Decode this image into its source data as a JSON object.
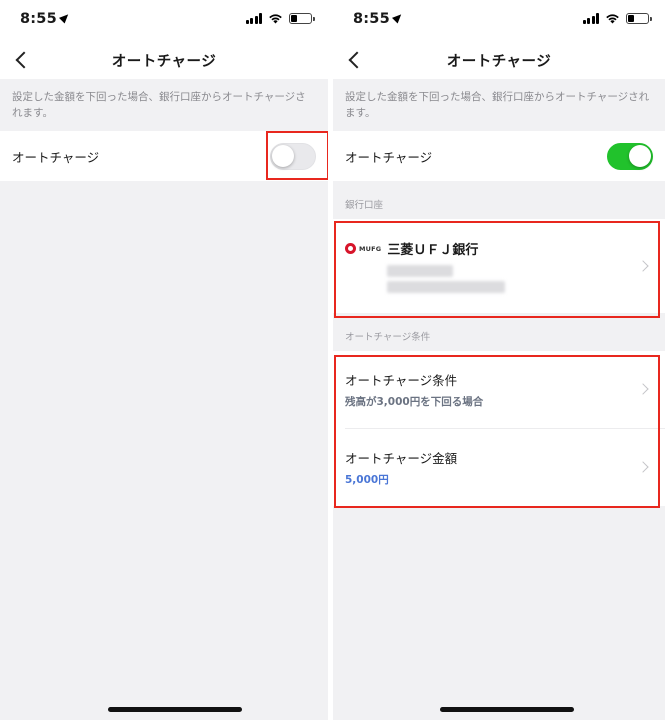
{
  "status_bar": {
    "time": "8:55"
  },
  "left_screen": {
    "nav_title": "オートチャージ",
    "description": "設定した金額を下回った場合、銀行口座からオートチャージされます。",
    "auto_charge_label": "オートチャージ",
    "auto_charge_enabled": false
  },
  "right_screen": {
    "nav_title": "オートチャージ",
    "description": "設定した金額を下回った場合、銀行口座からオートチャージされます。",
    "auto_charge_label": "オートチャージ",
    "auto_charge_enabled": true,
    "bank_section_header": "銀行口座",
    "bank": {
      "logo_text": "MUFG",
      "name": "三菱ＵＦＪ銀行"
    },
    "conditions_section_header": "オートチャージ条件",
    "conditions": [
      {
        "title": "オートチャージ条件",
        "value": "残高が3,000円を下回る場合"
      },
      {
        "title": "オートチャージ金額",
        "value": "5,000円"
      }
    ]
  },
  "colors": {
    "toggle_on": "#21c22c",
    "highlight": "#e8271e",
    "accent_value": "#4a76d6",
    "mufg_red": "#d7142a"
  }
}
